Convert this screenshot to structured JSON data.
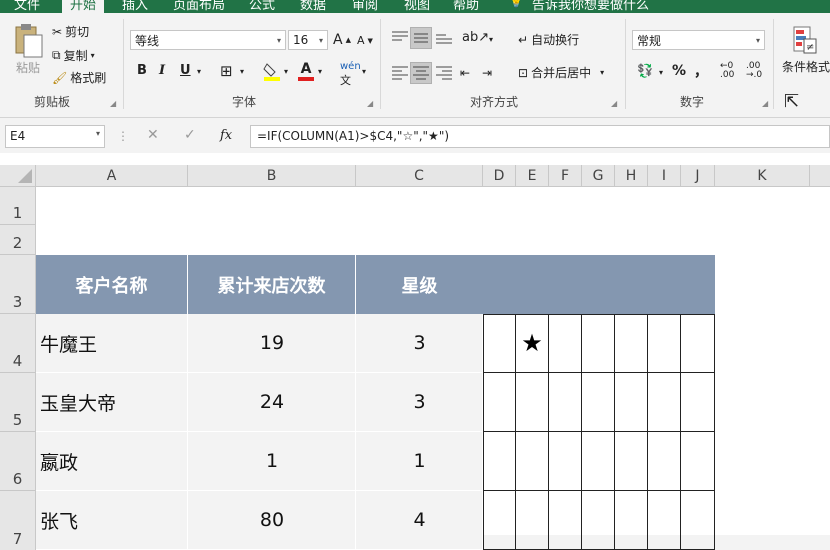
{
  "tabs": [
    "文件",
    "开始",
    "插入",
    "页面布局",
    "公式",
    "数据",
    "审阅",
    "视图",
    "帮助",
    "告诉我你想要做什么"
  ],
  "clipboard": {
    "paste": "粘贴",
    "cut": "剪切",
    "copy": "复制",
    "format_painter": "格式刷",
    "group": "剪贴板"
  },
  "font": {
    "name": "等线",
    "size": "16",
    "bold": "B",
    "italic": "I",
    "underline": "U",
    "grow": "A",
    "shrink": "A",
    "wen": "wén",
    "group": "字体"
  },
  "align": {
    "wrap": "自动换行",
    "merge": "合并后居中",
    "group": "对齐方式"
  },
  "number": {
    "format": "常规",
    "percent": "%",
    "comma": "，",
    "group": "数字"
  },
  "styles": {
    "conditional": "条件格式"
  },
  "formula_bar": {
    "name_box": "E4",
    "fx": "fx",
    "formula": "=IF(COLUMN(A1)>$C4,\"☆\",\"★\")"
  },
  "columns": [
    "A",
    "B",
    "C",
    "D",
    "E",
    "F",
    "G",
    "H",
    "I",
    "J",
    "K"
  ],
  "rows": [
    "1",
    "2",
    "3",
    "4",
    "5",
    "6",
    "7"
  ],
  "table": {
    "headers": [
      "客户名称",
      "累计来店次数",
      "星级"
    ],
    "rows": [
      {
        "name": "牛魔王",
        "visits": "19",
        "stars": "3"
      },
      {
        "name": "玉皇大帝",
        "visits": "24",
        "stars": "3"
      },
      {
        "name": "嬴政",
        "visits": "1",
        "stars": "1"
      },
      {
        "name": "张飞",
        "visits": "80",
        "stars": "4"
      }
    ]
  },
  "star_cell": "★",
  "colors": {
    "tabbar": "#217346",
    "header_fill": "#8497b0",
    "data_fill": "#f3f3f3"
  }
}
